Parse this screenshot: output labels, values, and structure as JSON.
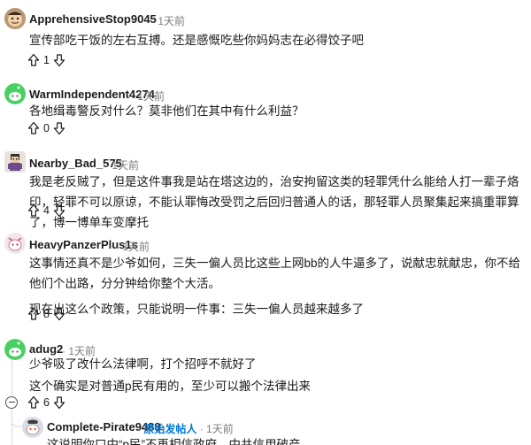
{
  "comments": [
    {
      "author": "ApprehensiveStop9045",
      "time": "1天前",
      "avatar_icon": "cartoon-face-avatar",
      "paragraphs": [
        "宣传部吃干饭的左右互搏。还是感慨吃些你妈妈志在必得饺子吧"
      ],
      "votes": "1"
    },
    {
      "author": "WarmIndependent4274",
      "time": "1天前",
      "avatar_icon": "green-snoo-avatar",
      "paragraphs": [
        "各地缉毒警反对什么？莫非他们在其中有什么利益？"
      ],
      "votes": "0"
    },
    {
      "author": "Nearby_Bad_575",
      "time": "1天前",
      "avatar_icon": "pixel-character-avatar",
      "paragraphs": [
        "我是老反贼了，但是这件事我是站在塔这边的，治安拘留这类的轻罪凭什么能给人打一辈子烙印，轻罪不可以原谅，不能认罪悔改受罚之后回归普通人的话，那轻罪人员聚集起来搞重罪算了，博一博单车变摩托"
      ],
      "votes": "4"
    },
    {
      "author": "HeavyPanzerPlus1s",
      "time": "1天前",
      "avatar_icon": "pink-snoo-avatar",
      "paragraphs": [
        "这事情还真不是少爷如何，三失一偏人员比这些上网bb的人牛逼多了，说献忠就献忠，你不给他们个出路，分分钟给你整个大活。",
        "现在出这么个政策，只能说明一件事：三失一偏人员越来越多了"
      ],
      "votes": "8"
    },
    {
      "author": "adug2",
      "time": "1天前",
      "avatar_icon": "green-snoo-avatar",
      "paragraphs": [
        "少爷吸了改什么法律啊，打个招呼不就好了",
        "这个确实是对普通p民有用的，至少可以搬个法律出来"
      ],
      "votes": "6"
    },
    {
      "author": "Complete-Pirate9488",
      "op_badge": "原始发帖人",
      "time": "1天前",
      "avatar_icon": "grey-snoo-avatar",
      "paragraphs": [
        "这说明你口中“p民”不再相信政府，中共信用破产"
      ]
    }
  ],
  "icons": {
    "upvote": "upvote-arrow-icon",
    "downvote": "downvote-arrow-icon",
    "collapse": "collapse-thread-icon"
  },
  "colors": {
    "accent": "#0079d3",
    "meta": "#7c7c7c",
    "thread_line": "#d9d9d9"
  }
}
